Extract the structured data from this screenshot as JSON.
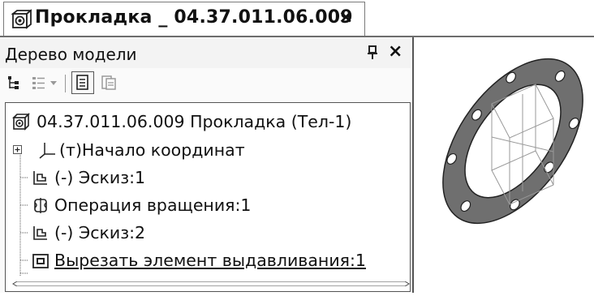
{
  "tab": {
    "title": "Прокладка _ 04.37.011.06.009",
    "close": "×",
    "icon": "part-icon"
  },
  "panel": {
    "title": "Дерево модели",
    "pin": "ᵖ",
    "close": "×"
  },
  "toolbar": {
    "icons": [
      "tree-view-icon",
      "list-view-icon",
      "dropdown-arrow-icon",
      "page-icon",
      "page-copy-icon"
    ]
  },
  "tree": {
    "items": [
      {
        "text": "04.37.011.06.009 Прокладка (Тел-1)",
        "icon": "part-icon"
      },
      {
        "text": "(т)Начало координат",
        "icon": "origin-icon"
      },
      {
        "text": "(-) Эскиз:1",
        "icon": "sketch-icon"
      },
      {
        "text": "Операция вращения:1",
        "icon": "revolve-icon"
      },
      {
        "text": "(-) Эскиз:2",
        "icon": "sketch-icon"
      },
      {
        "text": "Вырезать элемент выдавливания:1",
        "icon": "extrude-cut-icon"
      }
    ]
  },
  "viewport": {
    "object": "gasket-3d-model"
  }
}
